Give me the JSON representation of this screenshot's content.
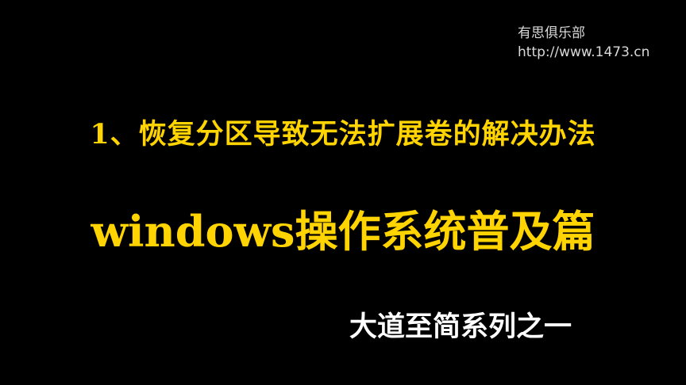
{
  "watermark": {
    "name": "有思俱乐部",
    "url": "http://www.1473.cn"
  },
  "slide": {
    "heading": "1、恢复分区导致无法扩展卷的解决办法",
    "title": "windows操作系统普及篇",
    "series": "大道至简系列之一"
  },
  "colors": {
    "background": "#000000",
    "title": "#ffd400",
    "series": "#ffffff",
    "watermark": "#d9d9d9"
  }
}
